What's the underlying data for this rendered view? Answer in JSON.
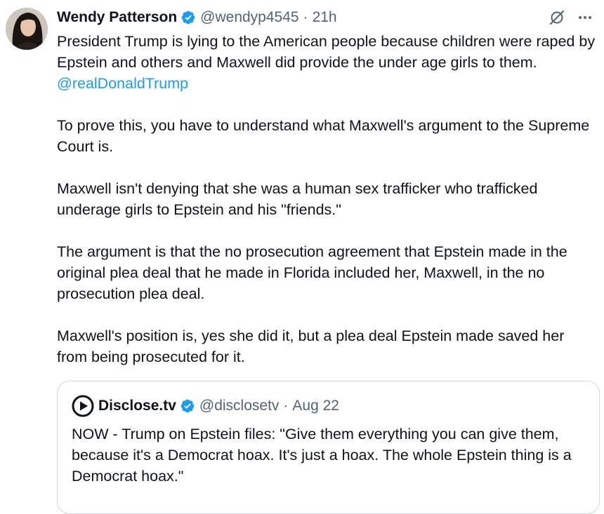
{
  "tweet": {
    "display_name": "Wendy Patterson",
    "handle": "@wendyp4545",
    "separator": "·",
    "time": "21h",
    "paragraphs": [
      "President Trump is lying to the American people because children were raped by Epstein and others and Maxwell did provide the under age girls to them.",
      "To prove this, you have to understand what Maxwell's argument to the Supreme Court is.",
      "Maxwell isn't denying that she was a human sex trafficker who trafficked underage girls to Epstein and his \"friends.\"",
      "The argument is that the no prosecution agreement that Epstein made in the original plea deal that he made in Florida included her, Maxwell, in the no prosecution plea deal.",
      "Maxwell's position is, yes she did it, but a plea deal Epstein made saved her from being prosecuted for it."
    ],
    "mention": "@realDonaldTrump",
    "icons": {
      "verified": "verified-badge-icon",
      "grok": "grok-icon",
      "more": "more-options-icon"
    }
  },
  "quote": {
    "display_name": "Disclose.tv",
    "handle": "@disclosetv",
    "separator": "·",
    "time": "Aug 22",
    "text": "NOW - Trump on Epstein files: \"Give them everything you can give them, because it's a Democrat hoax. It's just a hoax. The whole Epstein thing is a Democrat hoax.\"",
    "icons": {
      "logo": "disclose-play-logo-icon",
      "verified": "verified-badge-icon"
    }
  },
  "colors": {
    "text": "#0f1419",
    "secondary": "#536471",
    "link": "#1d9bf0",
    "verified": "#1d9bf0",
    "border": "#cfd9de"
  }
}
